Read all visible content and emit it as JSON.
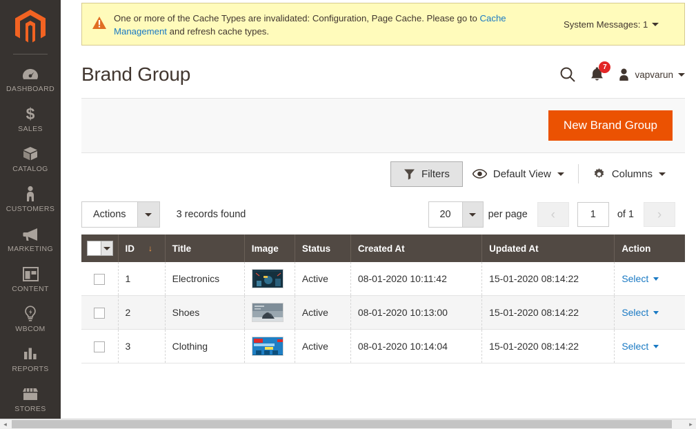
{
  "sidebar": {
    "logo_name": "magento-logo",
    "items": [
      {
        "label": "DASHBOARD",
        "icon": "dashboard-gauge-icon"
      },
      {
        "label": "SALES",
        "icon": "dollar-sign-icon"
      },
      {
        "label": "CATALOG",
        "icon": "box-icon"
      },
      {
        "label": "CUSTOMERS",
        "icon": "person-icon"
      },
      {
        "label": "MARKETING",
        "icon": "megaphone-icon"
      },
      {
        "label": "CONTENT",
        "icon": "layout-panel-icon"
      },
      {
        "label": "WBCOM",
        "icon": "lightbulb-icon"
      },
      {
        "label": "REPORTS",
        "icon": "bar-chart-icon"
      },
      {
        "label": "STORES",
        "icon": "storefront-icon"
      }
    ]
  },
  "banner": {
    "icon": "warning-triangle-icon",
    "text_before": "One or more of the Cache Types are invalidated: Configuration, Page Cache. Please go to ",
    "link_text": "Cache Management",
    "text_after": " and refresh cache types.",
    "system_messages_label": "System Messages: 1"
  },
  "header": {
    "title": "Brand Group",
    "search_icon": "search-icon",
    "notifications_icon": "bell-icon",
    "notifications_count": "7",
    "user_name": "vapvarun"
  },
  "action_bar": {
    "new_button_label": "New Brand Group",
    "new_button_color": "#eb5202"
  },
  "grid_toolbar": {
    "filters_label": "Filters",
    "view_label": "Default View",
    "columns_label": "Columns"
  },
  "actions_row": {
    "actions_label": "Actions",
    "records_found": "3 records found",
    "per_page_value": "20",
    "per_page_label": "per page",
    "page_value": "1",
    "page_total": "of 1",
    "prev_label": "‹",
    "next_label": "›"
  },
  "table": {
    "columns": [
      {
        "key": "checkbox",
        "label": ""
      },
      {
        "key": "id",
        "label": "ID",
        "sorted": true,
        "sort_arrow": "↓"
      },
      {
        "key": "title",
        "label": "Title"
      },
      {
        "key": "image",
        "label": "Image"
      },
      {
        "key": "status",
        "label": "Status"
      },
      {
        "key": "created_at",
        "label": "Created At"
      },
      {
        "key": "updated_at",
        "label": "Updated At"
      },
      {
        "key": "action",
        "label": "Action"
      }
    ],
    "rows": [
      {
        "id": "1",
        "title": "Electronics",
        "image_alt": "electronics-thumbnail",
        "image_colors": [
          "#1b3a4b",
          "#2e6f8e",
          "#d94f3d"
        ],
        "status": "Active",
        "created_at": "08-01-2020 10:11:42",
        "updated_at": "15-01-2020 08:14:22",
        "action_label": "Select"
      },
      {
        "id": "2",
        "title": "Shoes",
        "image_alt": "shoes-thumbnail",
        "image_colors": [
          "#9aa7b0",
          "#37414a",
          "#d8dde0"
        ],
        "status": "Active",
        "created_at": "08-01-2020 10:13:00",
        "updated_at": "15-01-2020 08:14:22",
        "action_label": "Select"
      },
      {
        "id": "3",
        "title": "Clothing",
        "image_alt": "clothing-thumbnail",
        "image_colors": [
          "#1f7fc4",
          "#e02b2b",
          "#0d4f7c"
        ],
        "status": "Active",
        "created_at": "08-01-2020 10:14:04",
        "updated_at": "15-01-2020 08:14:22",
        "action_label": "Select"
      }
    ]
  },
  "scrollbar": {
    "left_arrow": "◂",
    "right_arrow": "▸"
  }
}
